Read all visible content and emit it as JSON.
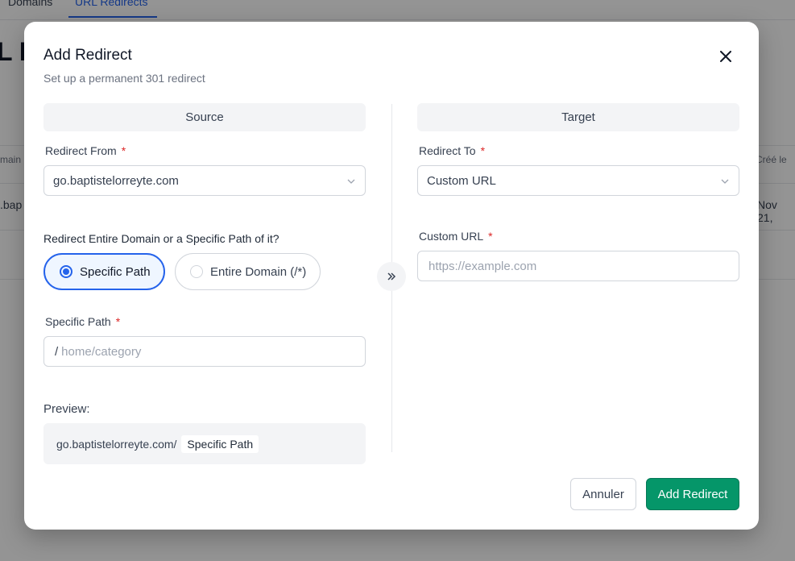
{
  "background": {
    "tabs": [
      "Domains",
      "URL Redirects"
    ],
    "heading": "L I",
    "table": {
      "col_domain": "main",
      "col_created": "Créé le",
      "row_domain": ".bap",
      "row_created": "Nov 21,"
    }
  },
  "modal": {
    "title": "Add Redirect",
    "subtitle": "Set up a permanent 301 redirect",
    "close_icon": "close-icon",
    "source": {
      "header": "Source",
      "redirect_from_label": "Redirect From",
      "redirect_from_value": "go.baptistelorreyte.com",
      "mode_question": "Redirect Entire Domain or a Specific Path of it?",
      "options": [
        {
          "label": "Specific Path",
          "selected": true
        },
        {
          "label": "Entire Domain (/*)",
          "selected": false
        }
      ],
      "specific_path_label": "Specific Path",
      "path_prefix": "/",
      "path_placeholder": "home/category",
      "preview_label": "Preview:",
      "preview_domain": "go.baptistelorreyte.com/",
      "preview_path": "Specific Path"
    },
    "target": {
      "header": "Target",
      "redirect_to_label": "Redirect To",
      "redirect_to_value": "Custom URL",
      "custom_url_label": "Custom URL",
      "custom_url_placeholder": "https://example.com"
    },
    "required_marker": "*",
    "swap_icon": "chevrons-right-icon",
    "buttons": {
      "cancel": "Annuler",
      "submit": "Add Redirect"
    }
  },
  "colors": {
    "accent": "#2563eb",
    "primary_button": "#059669",
    "required": "#dc2626"
  }
}
